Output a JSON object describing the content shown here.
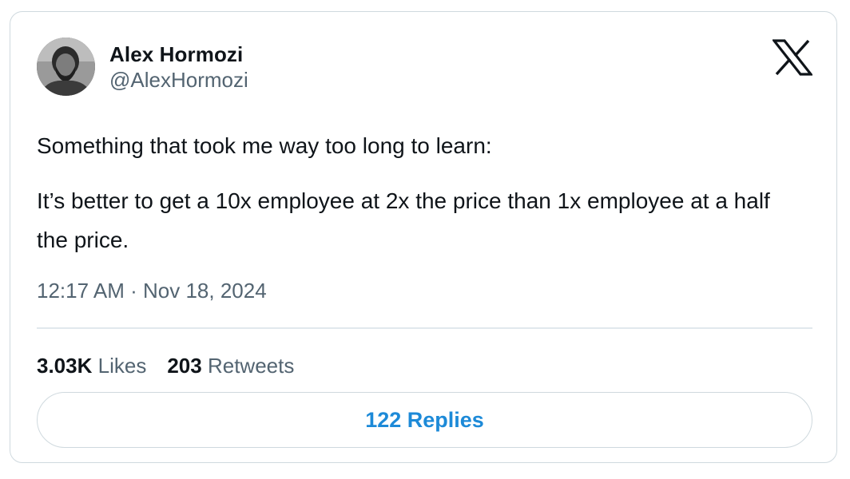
{
  "author": {
    "name": "Alex Hormozi",
    "handle": "@AlexHormozi",
    "avatar_icon": "avatar-photo"
  },
  "brand_icon": "x-logo-icon",
  "tweet": {
    "line1": "Something that took me way too long to learn:",
    "line2": "It’s better to get a 10x employee at 2x the price than 1x employee at a half the price."
  },
  "timestamp": {
    "time": "12:17 AM",
    "separator": "·",
    "date": "Nov 18, 2024"
  },
  "stats": {
    "likes_count": "3.03K",
    "likes_label": "Likes",
    "retweets_count": "203",
    "retweets_label": "Retweets"
  },
  "replies_button": {
    "label": "122 Replies"
  },
  "colors": {
    "text": "#0f1419",
    "secondary": "#536471",
    "border": "#cfd9de",
    "accent": "#1d8ad8"
  }
}
